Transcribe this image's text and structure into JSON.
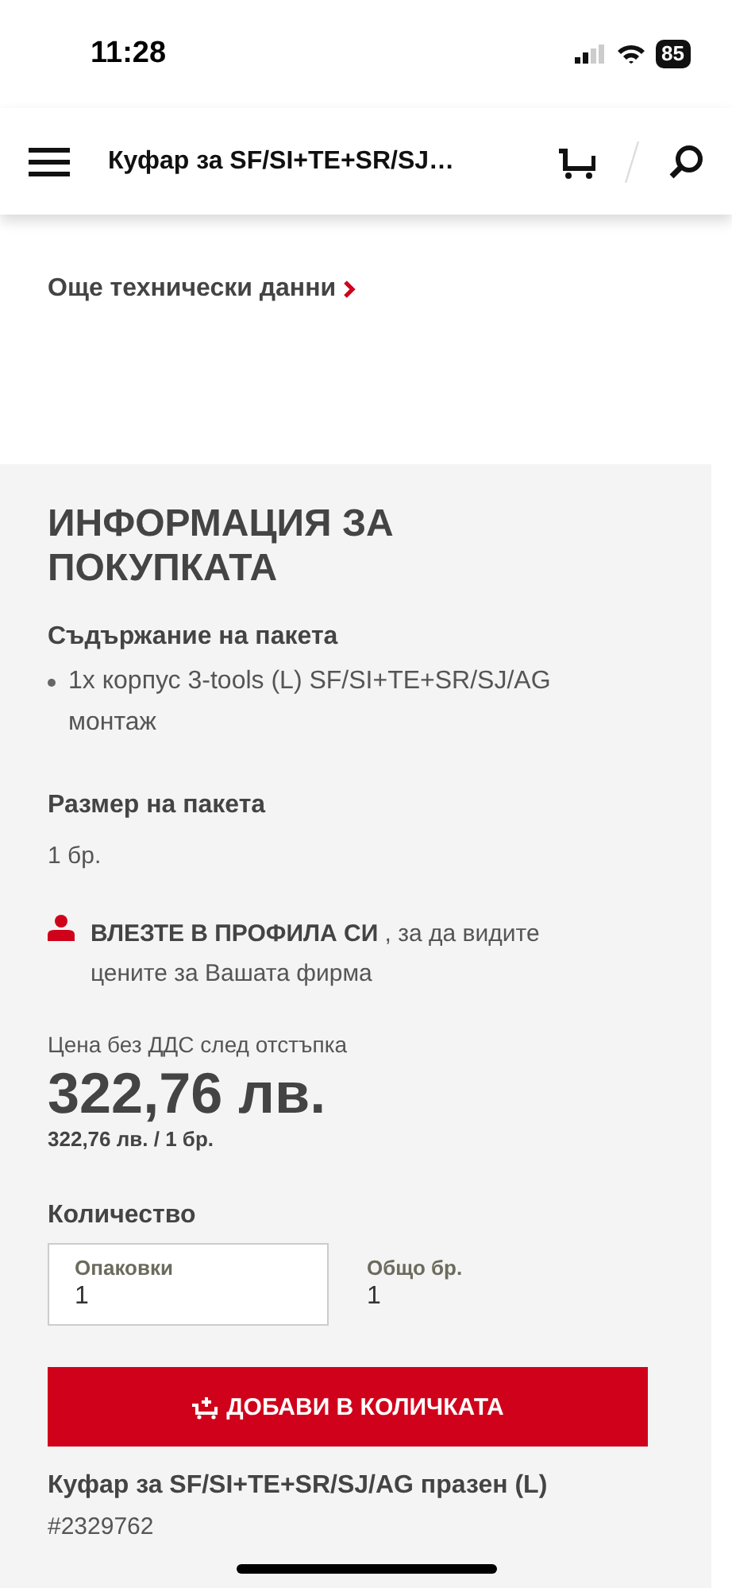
{
  "status_bar": {
    "time": "11:28",
    "battery": "85"
  },
  "header": {
    "title": "Куфар за SF/SI+TE+SR/SJ…"
  },
  "tech_link": {
    "label": "Още технически данни"
  },
  "purchase_info": {
    "title": "ИНФОРМАЦИЯ ЗА ПОКУПКАТА",
    "package_contents": {
      "label": "Съдържание на пакета",
      "items": [
        "1x корпус 3-tools (L) SF/SI+TE+SR/SJ/AG монтаж"
      ]
    },
    "package_size": {
      "label": "Размер на пакета",
      "value": "1 бр."
    },
    "login_notice": "**ВЛЕЗТЕ В ПРОФИЛА СИ** , за да видите цените за Вашата фирма",
    "price": {
      "label": "Цена без ДДС след отстъпка",
      "value": "322,76 лв.",
      "unit_price": "322,76 лв. / 1 бр."
    },
    "quantity": {
      "label": "Количество",
      "packages": {
        "label": "Опаковки",
        "value": "1"
      },
      "total": {
        "label": "Общо бр.",
        "value": "1"
      }
    },
    "add_to_cart": "ДОБАВИ В КОЛИЧКАТА",
    "product": {
      "name": "Куфар за SF/SI+TE+SR/SJ/AG празен (L)",
      "sku": "#2329762"
    }
  }
}
